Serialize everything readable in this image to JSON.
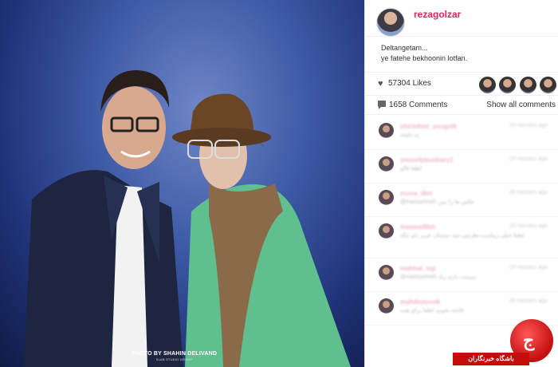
{
  "post": {
    "username": "rezagolzar",
    "caption_line1": "Deltangetam...",
    "caption_line2": "ye fatehe bekhoonin lotfan.",
    "likes": "57304 Likes",
    "comments_count": "1658 Comments",
    "show_all": "Show all comments"
  },
  "photo": {
    "credit": "PHOTO BY SHAHIN DELIVAND",
    "credit_sub": "SLAB STUDIO GROUP"
  },
  "comments": [
    {
      "user": "shirinfeet_yougolk",
      "time": "20 minutes ago",
      "text": "یه دقیقه"
    },
    {
      "user": "yousefpbunbary1",
      "time": "20 minutes ago",
      "text": "لطفا فالو"
    },
    {
      "user": "mona_dbn",
      "time": "20 minutes ago",
      "text": "@mansurimeh عکس ها را ببین"
    },
    {
      "user": "maseud6bh",
      "time": "20 minutes ago",
      "text": "لطفا خیلی زیباست نظرتون چیه دوستان عزیز دلم تنگه"
    },
    {
      "user": "mahhal_top",
      "time": "20 minutes ago",
      "text": "@mansurimeh دوستت دارم زیاد"
    },
    {
      "user": "mahdiotovn6",
      "time": "20 minutes ago",
      "text": "فاتحه بخونید لطفا برای همه"
    }
  ],
  "watermark": {
    "logo_glyph": "ج",
    "text": "باشگاه خبرنگاران"
  },
  "colors": {
    "username": "#e0245e",
    "watermark": "#c40e0e"
  }
}
